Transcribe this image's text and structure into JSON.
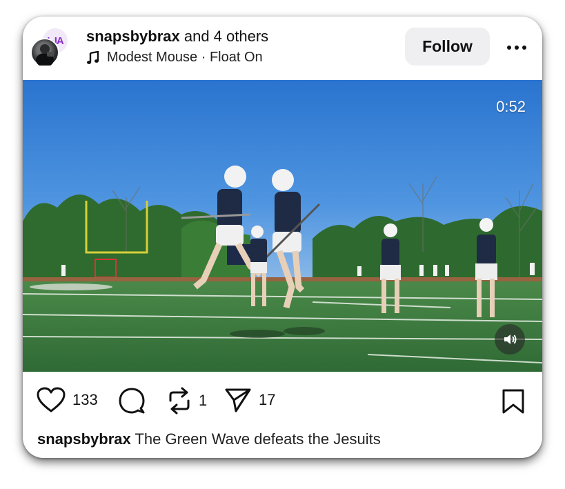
{
  "post": {
    "author": "snapsbybrax",
    "coauthors_text": "and 4 others",
    "music": "Modest Mouse · Float On",
    "follow_label": "Follow",
    "avatar_back_text": "ЫA"
  },
  "video": {
    "duration": "0:52",
    "scene": "lacrosse-practice-on-field"
  },
  "actions": {
    "likes": "133",
    "reposts": "1",
    "shares": "17"
  },
  "caption": {
    "author": "snapsbybrax",
    "text": "The Green Wave defeats the Jesuits"
  },
  "colors": {
    "follow_bg": "#efeff2",
    "sky": "#2f7fd4",
    "turf": "#3f7a40",
    "uniform_navy": "#1f2a44"
  },
  "icons": [
    "music-note-icon",
    "more-icon",
    "volume-icon",
    "heart-icon",
    "comment-icon",
    "repost-icon",
    "share-icon",
    "bookmark-icon"
  ]
}
